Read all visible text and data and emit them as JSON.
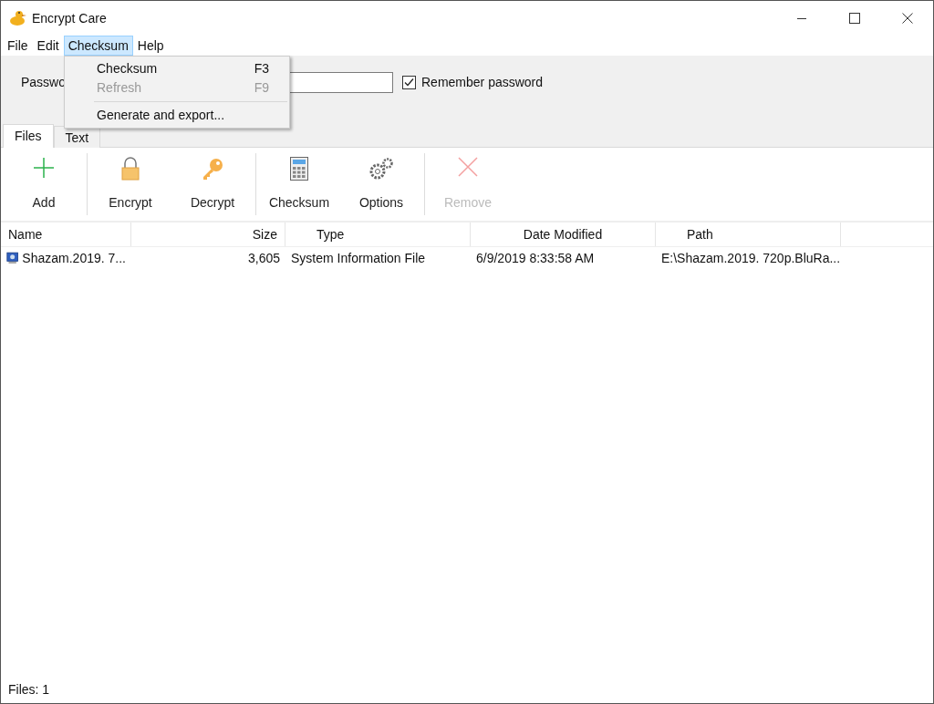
{
  "window": {
    "title": "Encrypt Care"
  },
  "menu_bar": [
    {
      "label": "File",
      "selected": false
    },
    {
      "label": "Edit",
      "selected": false
    },
    {
      "label": "Checksum",
      "selected": true
    },
    {
      "label": "Help",
      "selected": false
    }
  ],
  "open_menu": {
    "items": [
      {
        "kind": "item",
        "label": "Checksum",
        "shortcut": "F3",
        "disabled": false
      },
      {
        "kind": "item",
        "label": "Refresh",
        "shortcut": "F9",
        "disabled": true
      },
      {
        "kind": "separator"
      },
      {
        "kind": "item",
        "label": "Generate and export...",
        "disabled": false
      }
    ]
  },
  "password_bar": {
    "label": "Passwo",
    "remember": {
      "label": "Remember password",
      "checked": true
    }
  },
  "tabs": [
    {
      "label": "Files",
      "selected": true
    },
    {
      "label": "Text",
      "selected": false
    }
  ],
  "toolbar": [
    [
      {
        "label": "Add",
        "disabled": false
      }
    ],
    [
      {
        "label": "Encrypt",
        "disabled": false
      },
      {
        "label": "Decrypt",
        "disabled": false
      }
    ],
    [
      {
        "label": "Checksum",
        "disabled": false
      },
      {
        "label": "Options",
        "disabled": false
      }
    ],
    [
      {
        "label": "Remove",
        "disabled": true
      }
    ]
  ],
  "table": {
    "columns": [
      "Name",
      "Size",
      "Type",
      "Date Modified",
      "Path"
    ],
    "rows": [
      [
        "Shazam.2019. 7...",
        "3,605",
        "System Information File",
        "6/9/2019 8:33:58 AM",
        "E:\\Shazam.2019. 720p.BluRa..."
      ]
    ]
  },
  "status_bar": "Files: 1"
}
